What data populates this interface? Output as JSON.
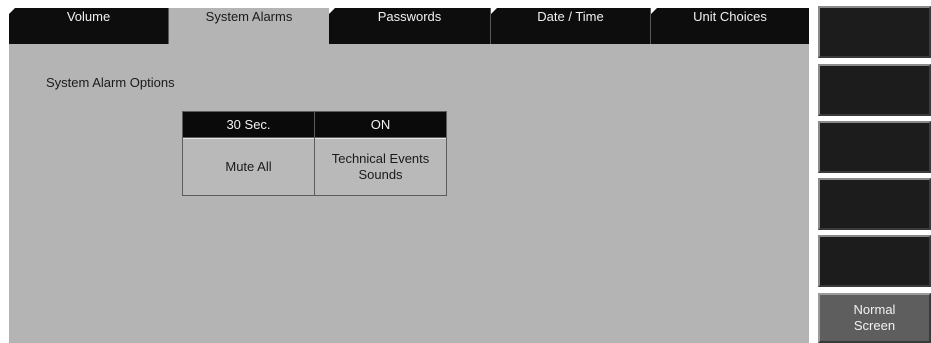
{
  "tabs": [
    {
      "label": "Volume",
      "active": false
    },
    {
      "label": "System Alarms",
      "active": true
    },
    {
      "label": "Passwords",
      "active": false
    },
    {
      "label": "Date / Time",
      "active": false
    },
    {
      "label": "Unit Choices",
      "active": false
    }
  ],
  "panel": {
    "title": "System Alarm Options"
  },
  "options": [
    {
      "value": "30 Sec.",
      "label": "Mute All"
    },
    {
      "value": "ON",
      "label": "Technical Events Sounds"
    }
  ],
  "sidebar": {
    "buttons": [
      "",
      "",
      "",
      "",
      ""
    ],
    "normal_screen_line1": "Normal",
    "normal_screen_line2": "Screen"
  },
  "colors": {
    "panel_bg": "#b4b4b4",
    "tab_bg": "#0d0d0d",
    "value_bg": "#0a0a0a",
    "side_button_bg": "#1c1c1c",
    "normal_screen_bg": "#5e5e5e"
  }
}
